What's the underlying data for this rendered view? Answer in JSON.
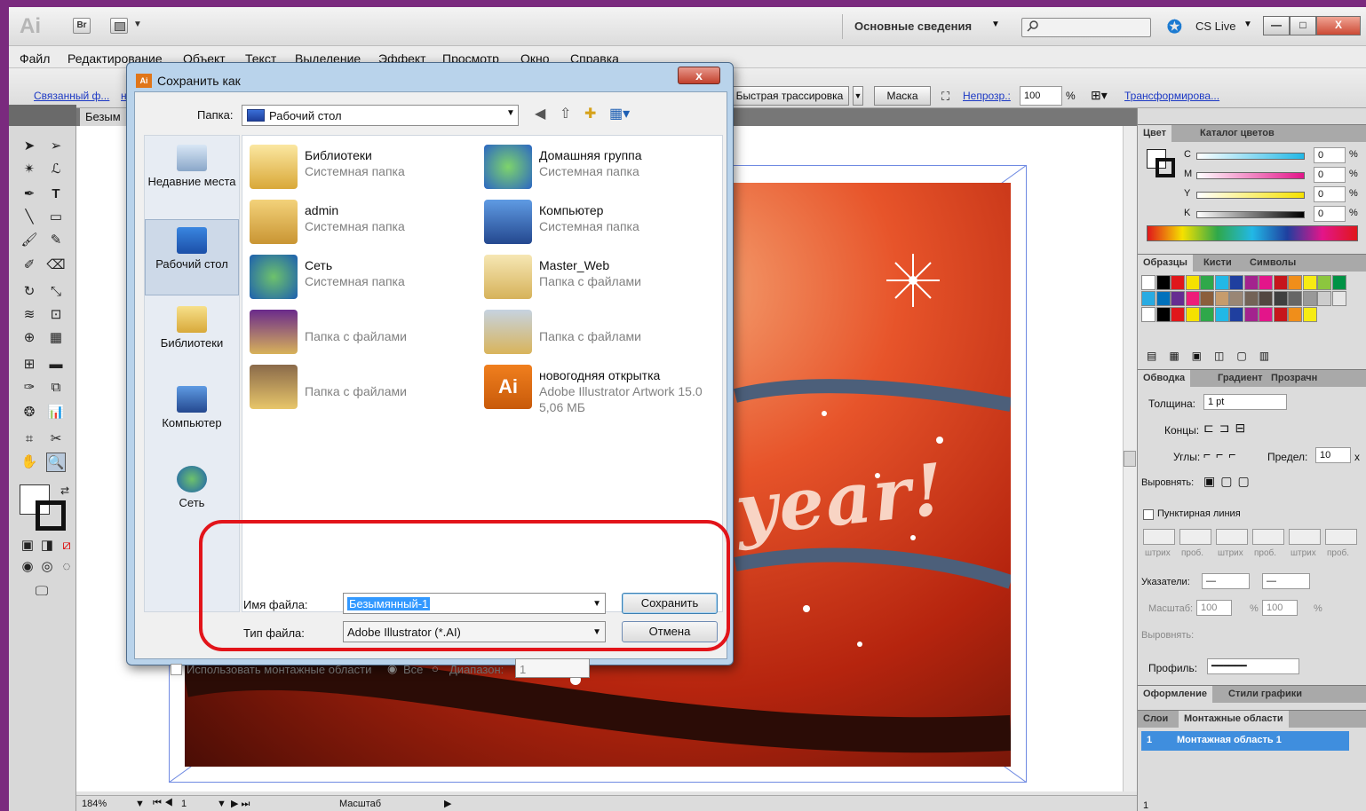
{
  "app": {
    "logo": "Ai",
    "bridge_label": "Br",
    "workspace": "Основные сведения",
    "cslive": "CS Live",
    "window_buttons": [
      "—",
      "□",
      "X"
    ]
  },
  "menu": [
    "Файл",
    "Редактирование",
    "Объект",
    "Текст",
    "Выделение",
    "Эффект",
    "Просмотр",
    "Окно",
    "Справка"
  ],
  "controlbar": {
    "linked_file": "Связанный ф...",
    "linked_file_suffix": "н",
    "trace": "Быстрая трассировка",
    "mask": "Маска",
    "opacity_label": "Непрозр.:",
    "opacity_value": "100",
    "opacity_unit": "%",
    "transform": "Трансформирова..."
  },
  "document_tab": "Безым",
  "canvas": {
    "artwork_text": "year!"
  },
  "statusbar": {
    "zoom": "184%",
    "page": "1",
    "scale_label": "Масштаб"
  },
  "panels": {
    "color": {
      "tabs": [
        "Цвет",
        "Каталог цветов"
      ],
      "channels": [
        {
          "label": "C",
          "value": "0",
          "unit": "%",
          "color": "#22b8e6"
        },
        {
          "label": "M",
          "value": "0",
          "unit": "%",
          "color": "#e3158a"
        },
        {
          "label": "Y",
          "value": "0",
          "unit": "%",
          "color": "#f5e100"
        },
        {
          "label": "K",
          "value": "0",
          "unit": "%",
          "color": "#000000"
        }
      ]
    },
    "swatches": {
      "tabs": [
        "Образцы",
        "Кисти",
        "Символы"
      ],
      "colors": [
        "#ffffff",
        "#000000",
        "#e0171b",
        "#f5e100",
        "#2fa84a",
        "#22b8e6",
        "#1f3f9f",
        "#a3238e",
        "#e3158a",
        "#c6161c",
        "#f08e1a",
        "#f6eb13",
        "#8cc63f",
        "#009245",
        "#29abe2",
        "#0071bc",
        "#662d91",
        "#ed1e79",
        "#8b5e3c",
        "#c69c6d",
        "#998675",
        "#736357",
        "#534741",
        "#3f3f3f",
        "#666666",
        "#999999",
        "#cccccc",
        "#e6e6e6"
      ]
    },
    "stroke": {
      "tabs": [
        "Обводка",
        "Градиент",
        "Прозрачн"
      ],
      "weight_label": "Толщина:",
      "weight_value": "1 pt",
      "caps_label": "Концы:",
      "corners_label": "Углы:",
      "limit_label": "Предел:",
      "limit_value": "10",
      "limit_unit": "x",
      "align_label": "Выровнять:",
      "dashed_label": "Пунктирная линия",
      "dash_labels": [
        "штрих",
        "проб.",
        "штрих",
        "проб.",
        "штрих",
        "проб."
      ],
      "arrows_label": "Указатели:",
      "scale_label": "Масштаб:",
      "scale_1": "100",
      "scale_2": "100",
      "scale_unit": "%",
      "align_arrows_label": "Выровнять:",
      "profile_label": "Профиль:"
    },
    "appearance": {
      "tabs": [
        "Оформление",
        "Стили графики"
      ]
    },
    "layers": {
      "tabs": [
        "Слои",
        "Монтажные области"
      ],
      "row_index": "1",
      "row_label": "Монтажная область 1",
      "footer_count": "1"
    }
  },
  "dialog": {
    "title": "Сохранить как",
    "close": "x",
    "folder_label": "Папка:",
    "folder_value": "Рабочий стол",
    "places": [
      "Недавние места",
      "Рабочий стол",
      "Библиотеки",
      "Компьютер",
      "Сеть"
    ],
    "files": [
      {
        "name": "Библиотеки",
        "sub": "Системная папка",
        "sub2": ""
      },
      {
        "name": "Домашняя группа",
        "sub": "Системная папка",
        "sub2": ""
      },
      {
        "name": "admin",
        "sub": "Системная папка",
        "sub2": ""
      },
      {
        "name": "Компьютер",
        "sub": "Системная папка",
        "sub2": ""
      },
      {
        "name": "Сеть",
        "sub": "Системная папка",
        "sub2": ""
      },
      {
        "name": "Master_Web",
        "sub": "Папка с файлами",
        "sub2": ""
      },
      {
        "name": "",
        "sub": "Папка с файлами",
        "sub2": ""
      },
      {
        "name": "",
        "sub": "Папка с файлами",
        "sub2": ""
      },
      {
        "name": "",
        "sub": "Папка с файлами",
        "sub2": ""
      },
      {
        "name": "новогодняя открытка",
        "sub": "Adobe Illustrator Artwork 15.0",
        "sub2": "5,06 МБ"
      }
    ],
    "filename_label": "Имя файла:",
    "filename_value": "Безымянный-1",
    "filetype_label": "Тип файла:",
    "filetype_value": "Adobe Illustrator (*.AI)",
    "save": "Сохранить",
    "cancel": "Отмена",
    "use_artboards": "Использовать монтажные области",
    "all": "Все",
    "range": "Диапазон:",
    "range_value": "1"
  }
}
